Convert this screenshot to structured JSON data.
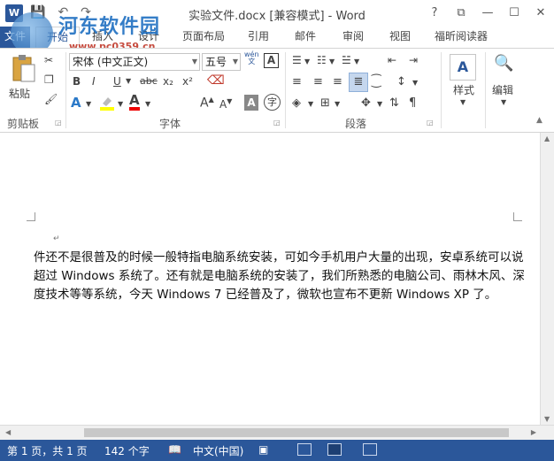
{
  "titlebar": {
    "logo": "W",
    "title": "实验文件.docx [兼容模式] - Word",
    "controls": {
      "help": "?",
      "restore_ribbon": "⧉",
      "minimize": "—",
      "maximize": "☐",
      "close": "✕"
    },
    "qat_icons": [
      "save-icon",
      "undo-icon",
      "redo-icon"
    ]
  },
  "watermark": {
    "title": "河东软件园",
    "url": "www.pc0359.cn"
  },
  "ribbon_tabs": {
    "file": "文件",
    "items": [
      "开始",
      "插入",
      "设计",
      "页面布局",
      "引用",
      "邮件",
      "审阅",
      "视图",
      "福昕阅读器"
    ],
    "active": "开始"
  },
  "ribbon": {
    "clipboard": {
      "paste": "粘贴",
      "label": "剪贴板"
    },
    "font": {
      "font_name": "宋体 (中文正文)",
      "font_size": "五号",
      "wen_char": "wén",
      "bold": "B",
      "italic": "I",
      "underline": "U",
      "strike": "abc",
      "subscript": "x₂",
      "superscript": "x²",
      "label": "字体",
      "text_effect": "A",
      "font_color": "A",
      "grow": "A",
      "shrink": "A",
      "char_shade": "A",
      "enclose": "字"
    },
    "paragraph": {
      "label": "段落"
    },
    "styles": {
      "label": "样式"
    },
    "editing": {
      "label": "编辑"
    }
  },
  "document": {
    "body": "件还不是很普及的时候一般特指电脑系统安装，可如今手机用户大量的出现，安卓系统可以说超过 Windows 系统了。还有就是电脑系统的安装了，我们所熟悉的电脑公司、雨林木风、深度技术等等系统，今天 Windows 7 已经普及了，微软也宣布不更新 Windows XP 了。",
    "para_mark": "↵"
  },
  "statusbar": {
    "page": "第 1 页，共 1 页",
    "words": "142 个字",
    "language": "中文(中国)"
  },
  "colors": {
    "accent": "#2b579a",
    "status_bg": "#2b579a"
  }
}
